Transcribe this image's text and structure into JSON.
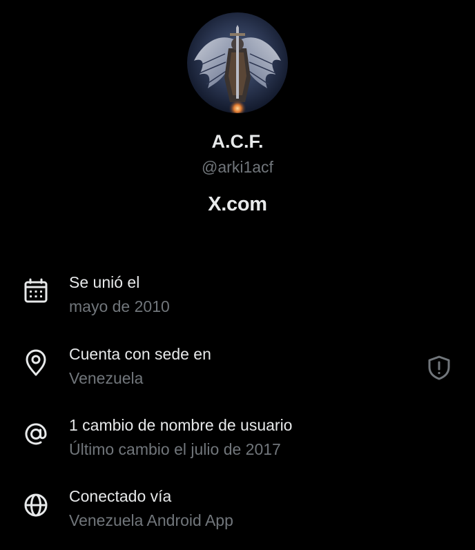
{
  "profile": {
    "name": "A.C.F.",
    "handle": "@arki1acf",
    "site": "X.com"
  },
  "details": [
    {
      "icon": "calendar-icon",
      "title": "Se unió el",
      "subtitle": "mayo de 2010"
    },
    {
      "icon": "location-pin-icon",
      "title": "Cuenta con sede en",
      "subtitle": "Venezuela",
      "badge_icon": "shield-alert-icon"
    },
    {
      "icon": "at-sign-icon",
      "title": "1 cambio de nombre de usuario",
      "subtitle": "Último cambio el julio de 2017"
    },
    {
      "icon": "globe-icon",
      "title": "Conectado vía",
      "subtitle": "Venezuela Android App"
    }
  ],
  "colors": {
    "background": "#000000",
    "primary_text": "#e7e9ea",
    "secondary_text": "#71767b",
    "icon": "#e7e9ea",
    "badge_icon": "#71767b"
  }
}
